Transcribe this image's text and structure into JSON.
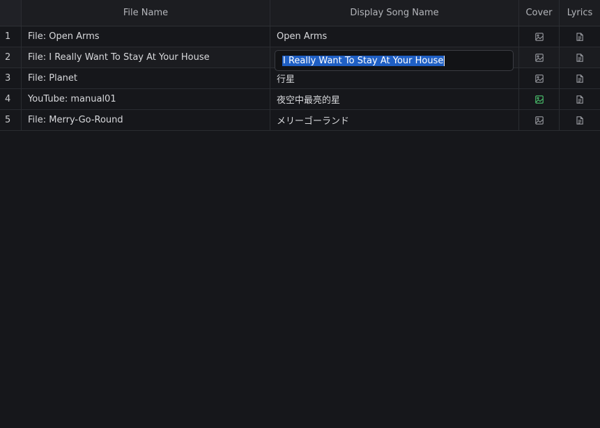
{
  "columns": {
    "file_name": "File Name",
    "display_song_name": "Display Song Name",
    "cover": "Cover",
    "lyrics": "Lyrics"
  },
  "rows": [
    {
      "index": "1",
      "file_name": "File: Open Arms",
      "display_name": "Open Arms",
      "cover_icon": "image-icon",
      "lyrics_icon": "document-icon",
      "cover_set": false
    },
    {
      "index": "2",
      "file_name": "File: I Really Want To Stay At Your House",
      "display_name": "I Really Want To Stay At Your House",
      "cover_icon": "image-icon",
      "lyrics_icon": "document-icon",
      "cover_set": false
    },
    {
      "index": "3",
      "file_name": "File: Planet",
      "display_name": "行星",
      "cover_icon": "image-icon",
      "lyrics_icon": "document-icon",
      "cover_set": false
    },
    {
      "index": "4",
      "file_name": "YouTube: manual01",
      "display_name": "夜空中最亮的星",
      "cover_icon": "image-icon",
      "lyrics_icon": "document-icon",
      "cover_set": true
    },
    {
      "index": "5",
      "file_name": "File: Merry-Go-Round",
      "display_name": "メリーゴーランド",
      "cover_icon": "image-icon",
      "lyrics_icon": "document-icon",
      "cover_set": false
    }
  ],
  "editor": {
    "value": "I Really Want To Stay At Your House"
  },
  "colors": {
    "background": "#16171b",
    "selection": "#1f5fc4",
    "cover_set": "#4cc870"
  }
}
